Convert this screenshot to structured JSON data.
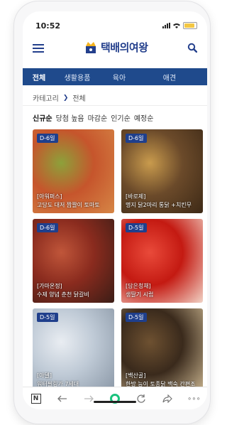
{
  "status": {
    "time": "10:52"
  },
  "header": {
    "title": "택배의여왕"
  },
  "tabs": [
    {
      "label": "전체",
      "active": true
    },
    {
      "label": "생활용품",
      "active": false
    },
    {
      "label": "육아",
      "active": false
    },
    {
      "label": "애견",
      "active": false
    }
  ],
  "breadcrumb": {
    "root": "카테고리",
    "current": "전체"
  },
  "sorts": [
    "신규순",
    "당첨 높음",
    "마감순",
    "인기순",
    "예정순"
  ],
  "cards": [
    {
      "badge": "D-6일",
      "category": "[아워퍼스]",
      "title": "고당도 대저 짭짤이 토마토",
      "colors": [
        "#c6552c",
        "#8da13a",
        "#d68646"
      ]
    },
    {
      "badge": "D-6일",
      "category": "[바로제]",
      "title": "명지 닭2마리 통닭 +치킨무",
      "colors": [
        "#6b4a2a",
        "#c99b4d",
        "#3d2916"
      ]
    },
    {
      "badge": "D-6일",
      "category": "[가마온정]",
      "title": "수제 양념 춘천 닭갈비",
      "colors": [
        "#8a2b1e",
        "#c0563a",
        "#3b1d16"
      ]
    },
    {
      "badge": "D-5일",
      "category": "[담은청채]",
      "title": "생딸기 시럽",
      "colors": [
        "#c41a12",
        "#e94a3a",
        "#f1d2c5"
      ]
    },
    {
      "badge": "D-5일",
      "category": "[아델]",
      "title": "워터필링가 7세대",
      "colors": [
        "#bfcad6",
        "#e9edf2",
        "#8a97a6"
      ]
    },
    {
      "badge": "D-5일",
      "category": "[백산골]",
      "title": "한방 능이 토종닭 백숙 간편조",
      "colors": [
        "#3a2a1c",
        "#6e5131",
        "#c9b48f"
      ]
    }
  ],
  "toolbar": {
    "n_label": "N"
  }
}
